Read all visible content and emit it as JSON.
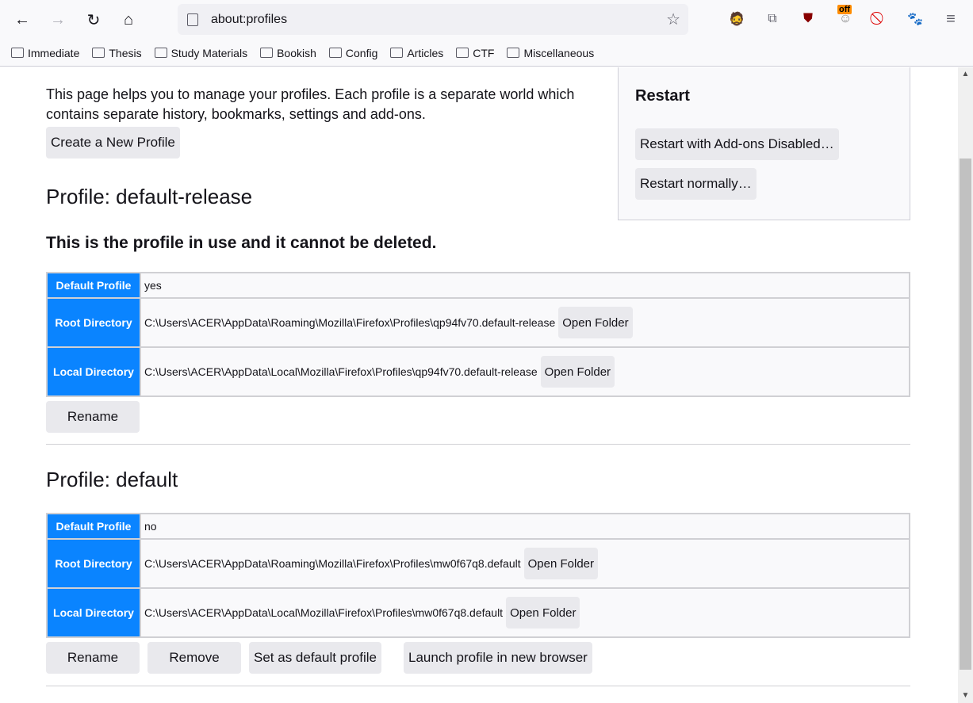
{
  "browser": {
    "url": "about:profiles",
    "extensions": [
      "avatar-icon",
      "extensions-icon",
      "ublock-origin-icon",
      "off-badge-extension-icon",
      "blocked-extension-icon",
      "gnome-foot-icon"
    ],
    "off_badge": "off"
  },
  "bookmarks": [
    "Immediate",
    "Thesis",
    "Study Materials",
    "Bookish",
    "Config",
    "Articles",
    "CTF",
    "Miscellaneous"
  ],
  "page": {
    "intro": "This page helps you to manage your profiles. Each profile is a separate world which contains separate history, bookmarks, settings and add-ons.",
    "create_label": "Create a New Profile",
    "restart": {
      "title": "Restart",
      "addons_disabled": "Restart with Add-ons Disabled…",
      "normally": "Restart normally…"
    },
    "labels": {
      "default": "Default Profile",
      "root": "Root Directory",
      "local": "Local Directory",
      "open_folder": "Open Folder",
      "rename": "Rename",
      "remove": "Remove",
      "set_default": "Set as default profile",
      "launch": "Launch profile in new browser"
    },
    "profiles": [
      {
        "title": "Profile: default-release",
        "in_use": "This is the profile in use and it cannot be deleted.",
        "default": "yes",
        "root": "C:\\Users\\ACER\\AppData\\Roaming\\Mozilla\\Firefox\\Profiles\\qp94fv70.default-release",
        "local": "C:\\Users\\ACER\\AppData\\Local\\Mozilla\\Firefox\\Profiles\\qp94fv70.default-release"
      },
      {
        "title": "Profile: default",
        "default": "no",
        "root": "C:\\Users\\ACER\\AppData\\Roaming\\Mozilla\\Firefox\\Profiles\\mw0f67q8.default",
        "local": "C:\\Users\\ACER\\AppData\\Local\\Mozilla\\Firefox\\Profiles\\mw0f67q8.default"
      }
    ]
  },
  "colors": {
    "accent": "#0a84ff"
  }
}
